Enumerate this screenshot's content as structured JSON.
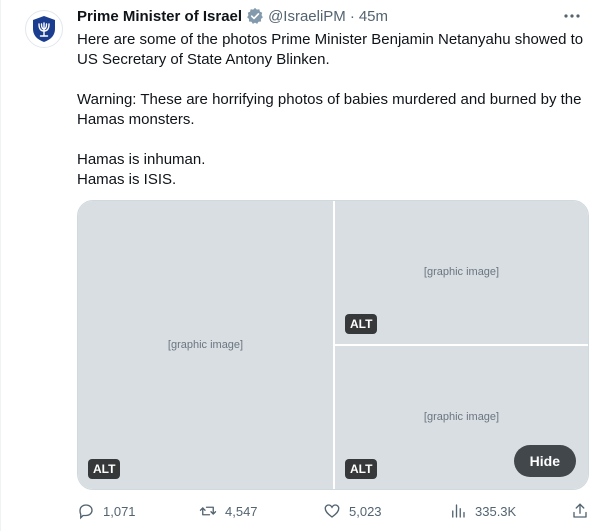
{
  "author": {
    "name": "Prime Minister of Israel",
    "handle": "@IsraeliPM",
    "separator": "·",
    "time": "45m",
    "avatar": "state-emblem-icon",
    "verified_badge": "government-verified-badge-icon",
    "verified_color": "#829aab"
  },
  "tweet": {
    "paragraph_1": "Here are some of the photos Prime Minister Benjamin Netanyahu showed to US Secretary of State Antony Blinken.",
    "paragraph_2": "Warning: These are horrifying photos of babies murdered and burned by the Hamas monsters.",
    "line_3": "Hamas is inhuman.",
    "line_4": "Hamas is ISIS."
  },
  "media": {
    "photos": [
      {
        "alt_tag": "ALT"
      },
      {
        "alt_tag": "ALT"
      },
      {
        "alt_tag": "ALT"
      }
    ],
    "hide_button": "Hide"
  },
  "actions": {
    "replies": "1,071",
    "retweets": "4,547",
    "likes": "5,023",
    "views": "335.3K"
  },
  "colors": {
    "text": "#0f1419",
    "secondary": "#536471",
    "border": "#cfd9de",
    "emblem": "#1a3d8f"
  }
}
